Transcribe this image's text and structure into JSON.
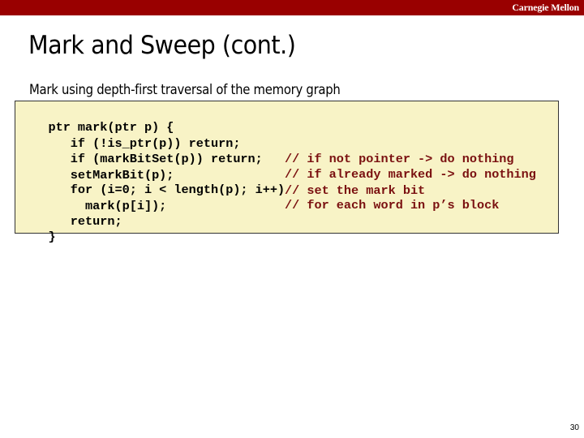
{
  "header": {
    "brand": "Carnegie Mellon",
    "accent_color": "#990000"
  },
  "slide": {
    "title": "Mark and Sweep (cont.)",
    "subtitle": "Mark using depth-first traversal of the memory graph",
    "page_number": "30"
  },
  "code": {
    "background_color": "#f8f3c6",
    "comment_color": "#7a1010",
    "lines": [
      {
        "text": "ptr mark(ptr p) {",
        "comment": ""
      },
      {
        "text": "   if (!is_ptr(p)) return;",
        "comment": "// if not pointer -> do nothing"
      },
      {
        "text": "   if (markBitSet(p)) return;",
        "comment": "// if already marked -> do nothing"
      },
      {
        "text": "   setMarkBit(p);",
        "comment": "// set the mark bit"
      },
      {
        "text": "   for (i=0; i < length(p); i++)",
        "comment": "// for each word in p’s block"
      },
      {
        "text": "     mark(p[i]);",
        "comment": ""
      },
      {
        "text": "   return;",
        "comment": ""
      },
      {
        "text": "}",
        "comment": ""
      }
    ]
  }
}
